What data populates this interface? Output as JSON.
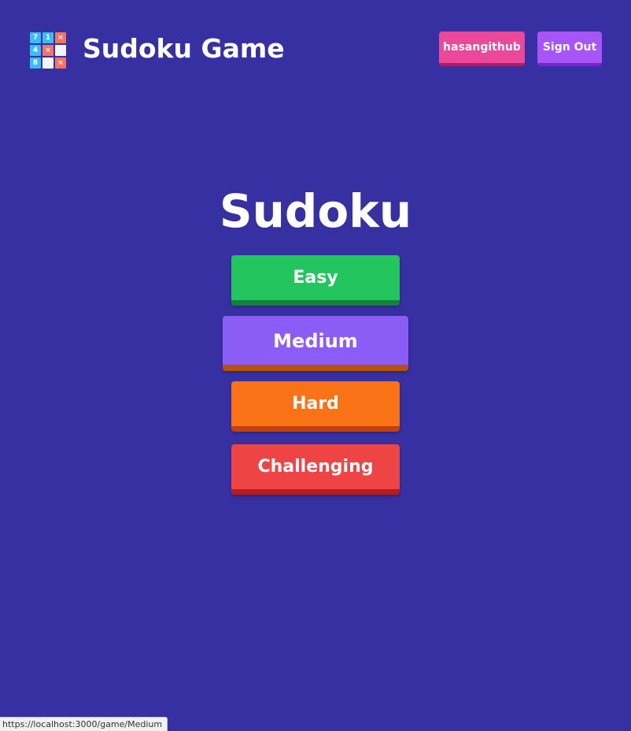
{
  "header": {
    "app_title": "Sudoku Game",
    "logo": {
      "icon": "sudoku-grid-icon",
      "cells": [
        "7",
        "1",
        "×",
        "4",
        "×",
        "",
        "8",
        "",
        "×"
      ]
    },
    "user_button_label": "hasangithub",
    "signout_button_label": "Sign Out"
  },
  "main": {
    "title": "Sudoku",
    "levels": [
      {
        "label": "Easy",
        "color": "#22c55e"
      },
      {
        "label": "Medium",
        "color": "#8b5cf6"
      },
      {
        "label": "Hard",
        "color": "#f97316"
      },
      {
        "label": "Challenging",
        "color": "#ef4444"
      }
    ]
  },
  "status_bar": {
    "url": "https://localhost:3000/game/Medium"
  },
  "colors": {
    "background": "#3730a3",
    "user_button": "#ec4899",
    "signout_button": "#a855f7"
  }
}
